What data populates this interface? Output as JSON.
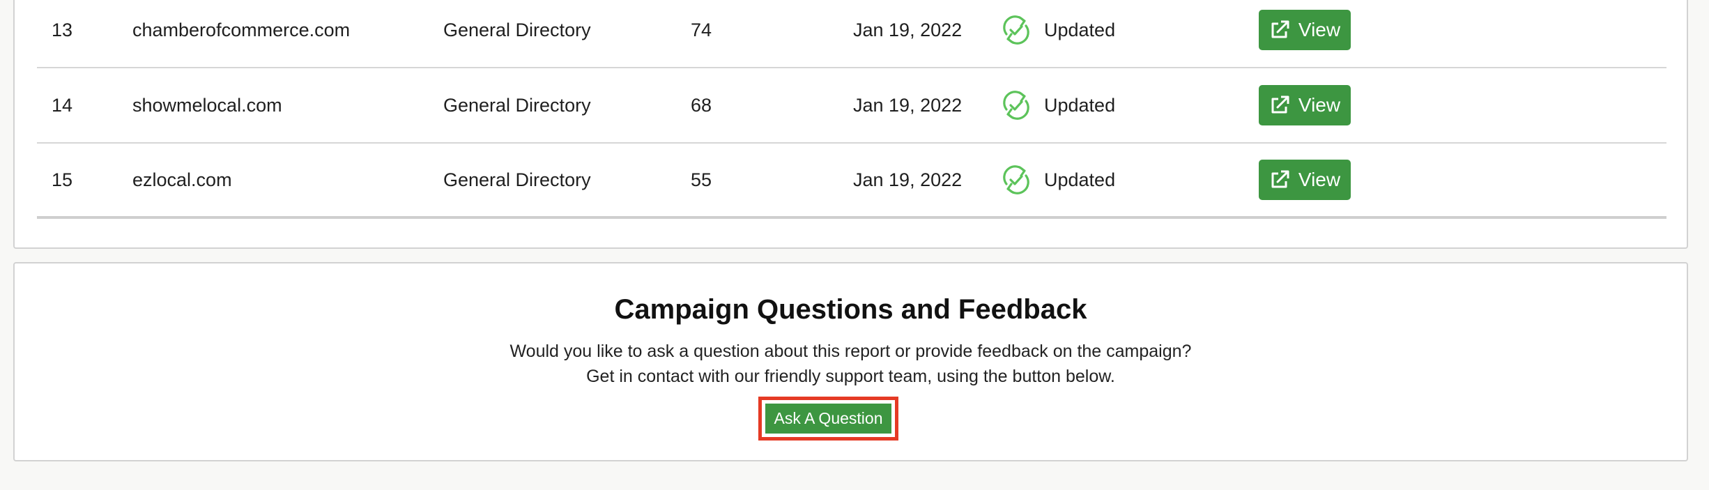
{
  "rows": [
    {
      "num": "13",
      "site": "chamberofcommerce.com",
      "type": "General Directory",
      "score": "74",
      "date": "Jan 19, 2022",
      "status": "Updated",
      "action": "View"
    },
    {
      "num": "14",
      "site": "showmelocal.com",
      "type": "General Directory",
      "score": "68",
      "date": "Jan 19, 2022",
      "status": "Updated",
      "action": "View"
    },
    {
      "num": "15",
      "site": "ezlocal.com",
      "type": "General Directory",
      "score": "55",
      "date": "Jan 19, 2022",
      "status": "Updated",
      "action": "View"
    }
  ],
  "feedback": {
    "title": "Campaign Questions and Feedback",
    "line1": "Would you like to ask a question about this report or provide feedback on the campaign?",
    "line2": "Get in contact with our friendly support team, using the button below.",
    "button_label": "Ask A Question"
  },
  "icons": {
    "status": "refresh-check-icon",
    "view": "external-link-icon"
  },
  "colors": {
    "accent_green": "#3d9641",
    "status_green": "#5cc35a",
    "highlight_red": "#e53a24"
  }
}
